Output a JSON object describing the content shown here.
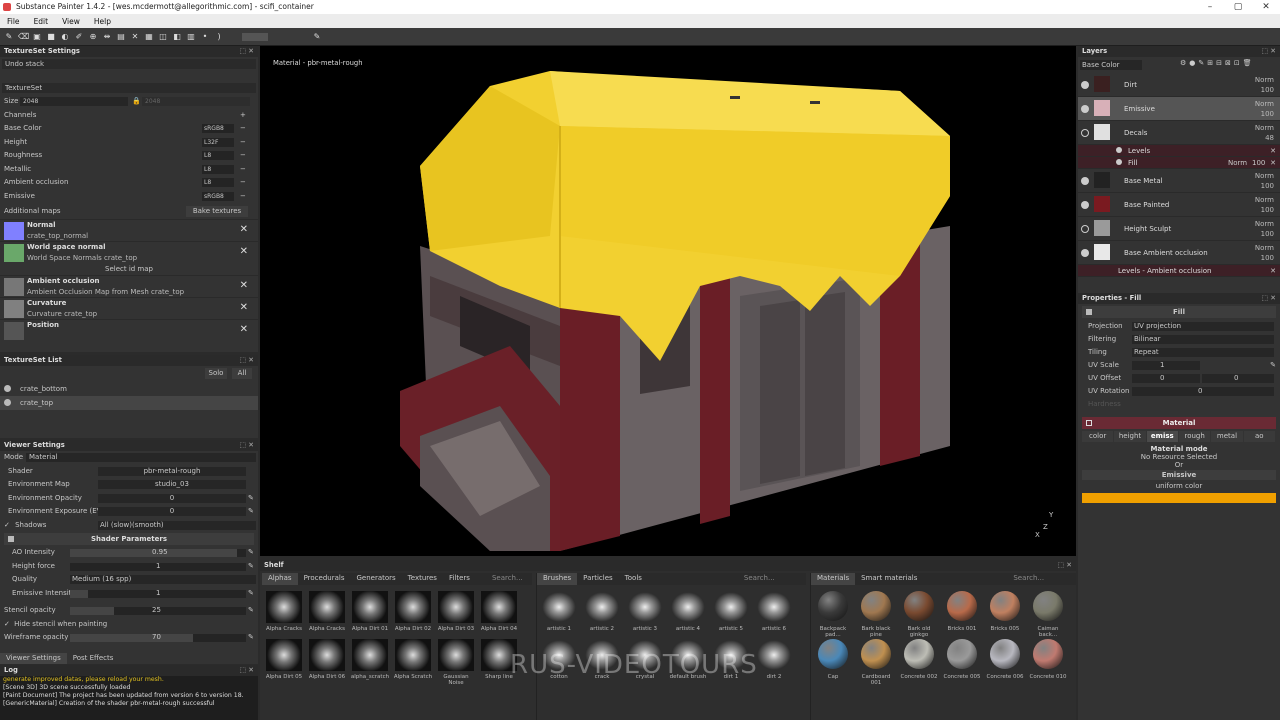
{
  "window": {
    "title": "Substance Painter 1.4.2 - [wes.mcdermott@allegorithmic.com] - scifi_container",
    "controls": [
      "–",
      "▢",
      "✕"
    ]
  },
  "menu": [
    "File",
    "Edit",
    "View",
    "Help"
  ],
  "textureset_settings": {
    "title": "TextureSet Settings",
    "undo_stack": "Undo stack",
    "textureset": "TextureSet",
    "size_label": "Size",
    "size_value": "2048",
    "size_link": "2048",
    "channels_label": "Channels",
    "channels": [
      {
        "name": "Base Color",
        "format": "sRGB8"
      },
      {
        "name": "Height",
        "format": "L32F"
      },
      {
        "name": "Roughness",
        "format": "L8"
      },
      {
        "name": "Metallic",
        "format": "L8"
      },
      {
        "name": "Ambient occlusion",
        "format": "L8"
      },
      {
        "name": "Emissive",
        "format": "sRGB8"
      }
    ],
    "additional_maps_label": "Additional maps",
    "bake_button": "Bake textures",
    "maps": [
      {
        "title": "Normal",
        "sub": "crate_top_normal",
        "color": "#8080ff"
      },
      {
        "title": "World space normal",
        "sub": "World Space Normals crate_top",
        "color": "#6aa86a"
      },
      {
        "title": "Ambient occlusion",
        "sub": "Ambient Occlusion Map from Mesh crate_top",
        "color": "#777777"
      },
      {
        "title": "Curvature",
        "sub": "Curvature crate_top",
        "color": "#808080"
      },
      {
        "title": "Position",
        "sub": "",
        "color": "#555555"
      }
    ],
    "select_id_map": "Select id map"
  },
  "textureset_list": {
    "title": "TextureSet List",
    "solo": "Solo",
    "all": "All",
    "items": [
      "crate_bottom",
      "crate_top"
    ]
  },
  "viewer_settings": {
    "title": "Viewer Settings",
    "mode_label": "Mode",
    "mode_value": "Material",
    "rows": [
      {
        "label": "Shader",
        "value": "pbr-metal-rough"
      },
      {
        "label": "Environment Map",
        "value": "studio_03"
      },
      {
        "label": "Environment Opacity",
        "value": "0"
      },
      {
        "label": "Environment Exposure (EV)",
        "value": "0"
      }
    ],
    "shadows_label": "Shadows",
    "shadows_value": "All (slow)(smooth)",
    "shader_params_title": "Shader Parameters",
    "ao_label": "AO Intensity",
    "ao_value": "0.95",
    "height_label": "Height force",
    "height_value": "1",
    "quality_label": "Quality",
    "quality_value": "Medium (16 spp)",
    "emissive_label": "Emissive Intensity",
    "emissive_value": "1",
    "stencil_label": "Stencil opacity",
    "stencil_value": "25",
    "hide_stencil_label": "Hide stencil when painting",
    "wireframe_label": "Wireframe opacity",
    "wireframe_value": "70",
    "tabs": [
      "Viewer Settings",
      "Post Effects"
    ]
  },
  "log": {
    "title": "Log",
    "lines": [
      "generate improved datas, please reload your mesh.",
      "[Scene 3D] 3D scene successfully loaded",
      "[Paint Document] The project has been updated from version 6 to version 18.",
      "[GenericMaterial] Creation of the shader pbr-metal-rough successful"
    ]
  },
  "viewport": {
    "material_label": "Material - pbr-metal-rough",
    "axis_x": "X",
    "axis_y": "Y",
    "axis_z": "Z"
  },
  "shelf": {
    "title": "Shelf",
    "left_tabs": [
      "Alphas",
      "Procedurals",
      "Generators",
      "Textures",
      "Filters"
    ],
    "search": "Search...",
    "alphas_row1": [
      "Alpha Cracks",
      "Alpha Cracks",
      "Alpha Dirt 01",
      "Alpha Dirt 02",
      "Alpha Dirt 03",
      "Alpha Dirt 04"
    ],
    "alphas_row2": [
      "Alpha Dirt 05",
      "Alpha Dirt 06",
      "alpha_scratch",
      "Alpha Scratch",
      "Gaussian Noise",
      "Sharp line"
    ],
    "mid_tabs": [
      "Brushes",
      "Particles",
      "Tools"
    ],
    "brushes_row1": [
      "artistic 1",
      "artistic 2",
      "artistic 3",
      "artistic 4",
      "artistic 5",
      "artistic 6"
    ],
    "brushes_row2": [
      "cotton",
      "crack",
      "crystal",
      "default brush",
      "dirt 1",
      "dirt 2"
    ],
    "right_tabs": [
      "Materials",
      "Smart materials"
    ],
    "materials_row1": [
      "Backpack pad...",
      "Bark black pine",
      "Bark old ginkgo",
      "Bricks 001",
      "Bricks 005",
      "Caiman back..."
    ],
    "materials_row2": [
      "Cap",
      "Cardboard 001",
      "Concrete 002",
      "Concrete 005",
      "Concrete 006",
      "Concrete 010"
    ],
    "materials_colors_row1": [
      "#3a3a3a",
      "#a07850",
      "#7a4a30",
      "#b86a4a",
      "#c08060",
      "#7a7a6a"
    ],
    "materials_colors_row2": [
      "#4a88b8",
      "#c09050",
      "#bdbdb5",
      "#9a9a9a",
      "#b8b8c0",
      "#c07a70"
    ],
    "watermark": "RUS-VIDEOTOURS"
  },
  "layers": {
    "title": "Layers",
    "channel_select": "Base Color",
    "items": [
      {
        "name": "Dirt",
        "blend": "Norm",
        "opacity": "100",
        "visible": true,
        "color": "#3a2020"
      },
      {
        "name": "Emissive",
        "blend": "Norm",
        "opacity": "100",
        "visible": true,
        "color": "#d8b0b8",
        "selected": true
      },
      {
        "name": "Decals",
        "blend": "Norm",
        "opacity": "48",
        "visible": false,
        "color": "#e0e0e0"
      }
    ],
    "decals_sub": [
      {
        "name": "Levels"
      },
      {
        "name": "Fill",
        "blend": "Norm",
        "opacity": "100"
      }
    ],
    "items2": [
      {
        "name": "Base Metal",
        "blend": "Norm",
        "opacity": "100",
        "visible": true,
        "color": "#222222"
      },
      {
        "name": "Base Painted",
        "blend": "Norm",
        "opacity": "100",
        "visible": true,
        "color": "#7a1a20"
      },
      {
        "name": "Height Sculpt",
        "blend": "Norm",
        "opacity": "100",
        "visible": false,
        "color": "#9a9a9a"
      },
      {
        "name": "Base Ambient occlusion",
        "blend": "Norm",
        "opacity": "100",
        "visible": true,
        "color": "#e8e8e8"
      }
    ],
    "ao_sub": "Levels - Ambient occlusion"
  },
  "properties": {
    "title": "Properties - Fill",
    "fill_label": "Fill",
    "rows": [
      {
        "label": "Projection",
        "value": "UV projection"
      },
      {
        "label": "Filtering",
        "value": "Bilinear"
      },
      {
        "label": "Tiling",
        "value": "Repeat"
      }
    ],
    "uv_scale_label": "UV Scale",
    "uv_scale_value": "1",
    "uv_offset_label": "UV Offset",
    "uv_offset_value": "0",
    "uv_offset_value2": "0",
    "uv_rotation_label": "UV Rotation",
    "uv_rotation_value": "0",
    "hardness_label": "Hardness",
    "material_title": "Material",
    "channel_tabs": [
      "color",
      "height",
      "emiss",
      "rough",
      "metal",
      "ao"
    ],
    "material_mode": "Material mode",
    "no_resource": "No Resource Selected",
    "or": "Or",
    "emissive_title": "Emissive",
    "uniform_color": "uniform color",
    "emissive_color": "#f0a000"
  }
}
